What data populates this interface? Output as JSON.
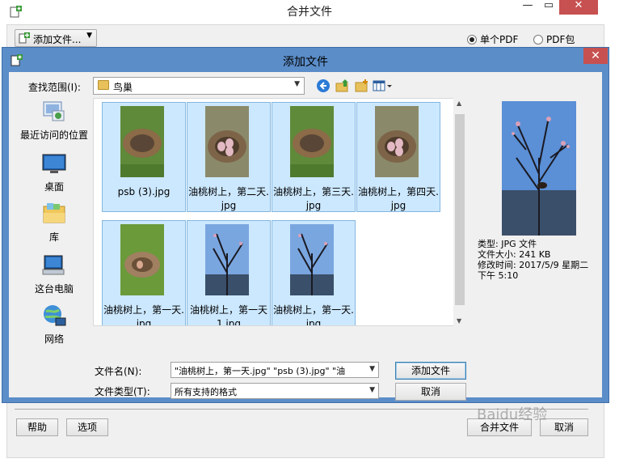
{
  "parent": {
    "title": "合并文件",
    "add_file_btn": "添加文件...",
    "radio_single": "单个PDF",
    "radio_package": "PDF包",
    "help_btn": "帮助",
    "options_btn": "选项",
    "merge_btn": "合并文件",
    "cancel_btn": "取消"
  },
  "dialog": {
    "title": "添加文件",
    "lookin_label": "查找范围(I):",
    "lookin_value": "鸟巢",
    "places": [
      {
        "label": "最近访问的位置",
        "icon": "recent-places-icon"
      },
      {
        "label": "桌面",
        "icon": "desktop-icon"
      },
      {
        "label": "库",
        "icon": "libraries-icon"
      },
      {
        "label": "这台电脑",
        "icon": "this-pc-icon"
      },
      {
        "label": "网络",
        "icon": "network-icon"
      }
    ],
    "files": [
      {
        "name": "psb (3).jpg",
        "kind": "nest-empty"
      },
      {
        "name": "油桃树上，第二天.jpg",
        "kind": "nest-eggs"
      },
      {
        "name": "油桃树上，第三天.jpg",
        "kind": "nest-empty"
      },
      {
        "name": "油桃树上，第四天.jpg",
        "kind": "nest-eggs"
      },
      {
        "name": "油桃树上，第一天.jpg",
        "kind": "nest-one"
      },
      {
        "name": "油桃树上，第一天1.jpg",
        "kind": "tree"
      },
      {
        "name": "油桃树上，第一天.jpg",
        "kind": "tree"
      }
    ],
    "preview": {
      "type_line": "类型: JPG 文件",
      "size_line": "文件大小: 241 KB",
      "modified_line": "修改时间: 2017/5/9 星期二",
      "modified_line2": "下午 5:10"
    },
    "filename_label": "文件名(N):",
    "filename_value": "\"油桃树上，第一天.jpg\" \"psb (3).jpg\" \"油",
    "filetype_label": "文件类型(T):",
    "filetype_value": "所有支持的格式",
    "add_btn": "添加文件",
    "cancel_btn": "取消"
  },
  "watermark": "Baidu经验"
}
